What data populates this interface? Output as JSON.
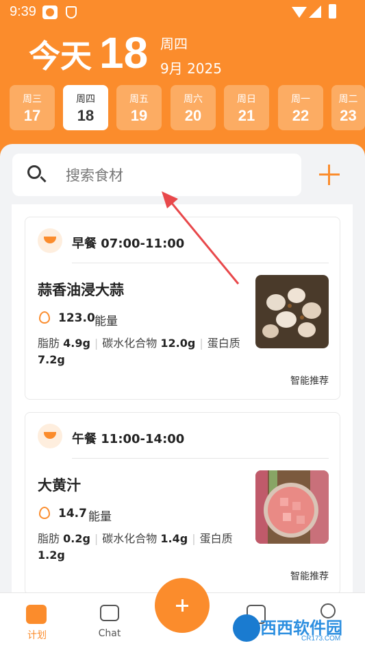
{
  "status_bar": {
    "time": "9:39"
  },
  "header": {
    "today_label": "今天",
    "day_number": "18",
    "weekday": "周四",
    "month_year": "9月 2025"
  },
  "week_days": [
    {
      "weekday": "周三",
      "day": "17"
    },
    {
      "weekday": "周四",
      "day": "18"
    },
    {
      "weekday": "周五",
      "day": "19"
    },
    {
      "weekday": "周六",
      "day": "20"
    },
    {
      "weekday": "周日",
      "day": "21"
    },
    {
      "weekday": "周一",
      "day": "22"
    },
    {
      "weekday": "周二",
      "day": "23"
    }
  ],
  "search": {
    "placeholder": "搜索食材"
  },
  "meals": [
    {
      "title": "早餐 07:00-11:00",
      "food_name": "蒜香油浸大蒜",
      "kcal_value": "123.0",
      "kcal_label": "能量",
      "fat_label": "脂肪",
      "fat_value": "4.9g",
      "carb_label": "碳水化合物",
      "carb_value": "12.0g",
      "protein_label": "蛋白质",
      "protein_value": "7.2g",
      "recommend": "智能推荐"
    },
    {
      "title": "午餐 11:00-14:00",
      "food_name": "大黄汁",
      "kcal_value": "14.7",
      "kcal_label": "能量",
      "fat_label": "脂肪",
      "fat_value": "0.2g",
      "carb_label": "碳水化合物",
      "carb_value": "1.4g",
      "protein_label": "蛋白质",
      "protein_value": "1.2g",
      "recommend": "智能推荐"
    }
  ],
  "bottom_nav": {
    "plan_label": "计划",
    "chat_label": "Chat"
  },
  "watermark": {
    "text": "西西软件园",
    "url": "CR173.COM"
  },
  "colors": {
    "accent": "#fb8c2c",
    "chip": "#fcac63",
    "annotation_arrow": "#e8484b"
  }
}
